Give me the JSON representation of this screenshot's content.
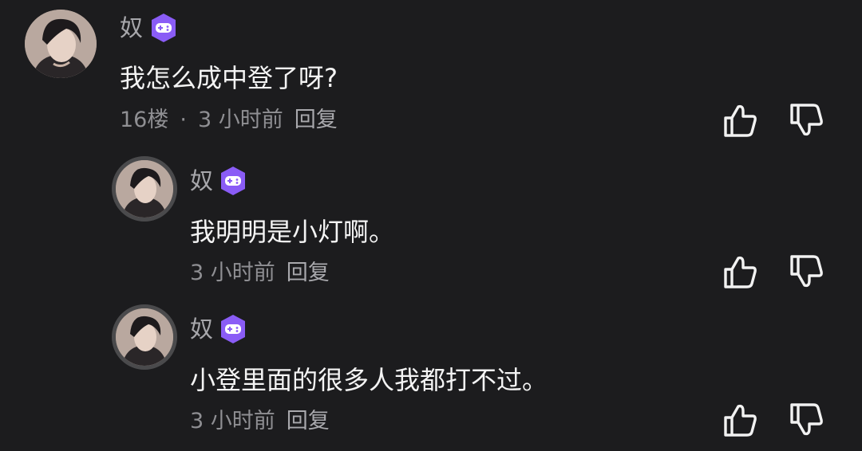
{
  "comments": [
    {
      "username": "奴",
      "badge_icon": "gamepad-badge-icon",
      "text": "我怎么成中登了呀?",
      "floor": "16楼",
      "separator": "·",
      "time": "3 小时前",
      "reply_label": "回复",
      "like_icon": "thumbs-up-icon",
      "dislike_icon": "thumbs-down-icon"
    },
    {
      "username": "奴",
      "badge_icon": "gamepad-badge-icon",
      "text": "我明明是小灯啊。",
      "time": "3 小时前",
      "reply_label": "回复",
      "like_icon": "thumbs-up-icon",
      "dislike_icon": "thumbs-down-icon"
    },
    {
      "username": "奴",
      "badge_icon": "gamepad-badge-icon",
      "text": "小登里面的很多人我都打不过。",
      "time": "3 小时前",
      "reply_label": "回复",
      "like_icon": "thumbs-up-icon",
      "dislike_icon": "thumbs-down-icon"
    }
  ],
  "colors": {
    "background": "#1c1c1e",
    "badge": "#8a5cf6",
    "text": "#f4f4f4",
    "muted": "#8f8f93"
  }
}
